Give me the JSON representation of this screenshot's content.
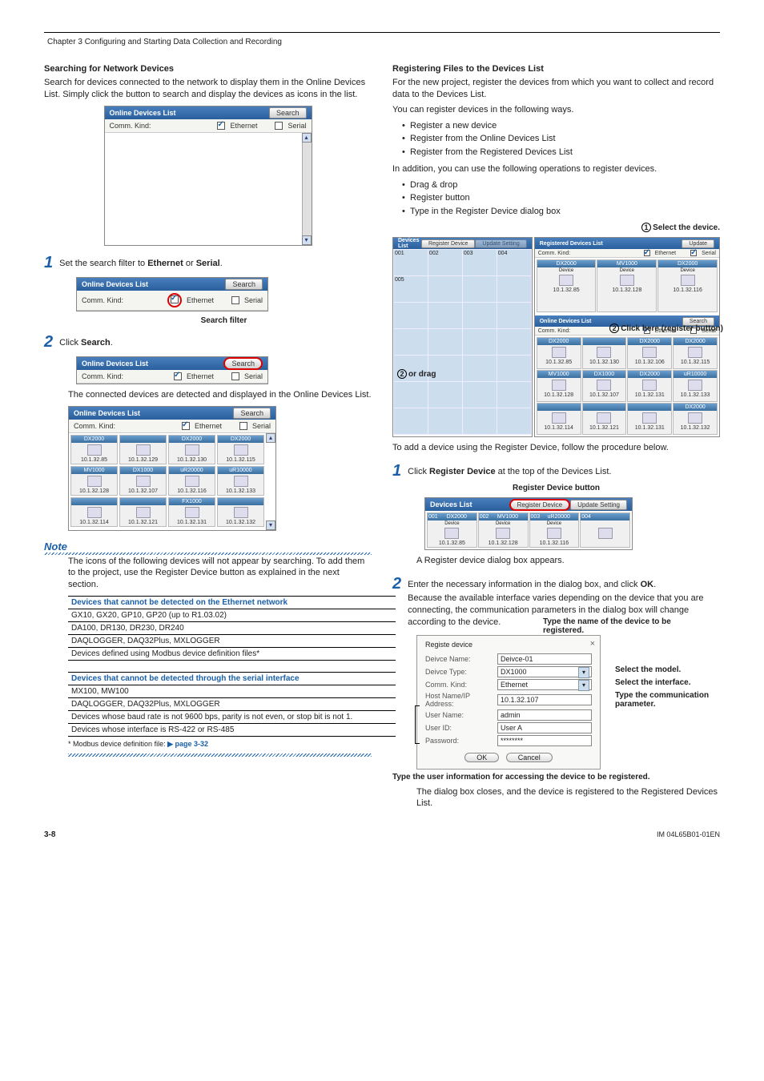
{
  "chapter": "Chapter 3  Configuring and Starting Data Collection and Recording",
  "left": {
    "h1": "Searching for Network Devices",
    "p1": "Search for devices connected to the network to display them in the Online Devices List. Simply click the button to search and display the devices as icons in the list.",
    "panel1": {
      "title": "Online Devices List",
      "search": "Search",
      "commkind": "Comm. Kind:",
      "eth": "Ethernet",
      "ser": "Serial"
    },
    "step1": "Set the search filter to Ethernet or Serial.",
    "search_filter_label": "Search filter",
    "step2": "Click Search.",
    "p2": "The connected devices are detected and displayed in the Online Devices List.",
    "devices": [
      {
        "n": "DX2000",
        "ip": "10.1.32.85"
      },
      {
        "n": "",
        "ip": "10.1.32.129"
      },
      {
        "n": "DX2000",
        "ip": "10.1.32.130"
      },
      {
        "n": "DX2000",
        "ip": "10.1.32.115"
      },
      {
        "n": "MV1000",
        "ip": "10.1.32.128"
      },
      {
        "n": "DX1000",
        "ip": "10.1.32.107"
      },
      {
        "n": "uR20000",
        "ip": "10.1.32.116"
      },
      {
        "n": "uR10000",
        "ip": "10.1.32.133"
      },
      {
        "n": "",
        "ip": "10.1.32.114"
      },
      {
        "n": "",
        "ip": "10.1.32.121"
      },
      {
        "n": "FX1000",
        "ip": "10.1.32.131"
      },
      {
        "n": "",
        "ip": "10.1.32.132"
      }
    ],
    "note": "Note",
    "note_p": "The icons of the following devices will not appear by searching. To add them to the project, use the Register Device button as explained in the next section.",
    "tbl1_hdr": "Devices that cannot be detected on the Ethernet network",
    "tbl1": [
      "GX10, GX20, GP10, GP20 (up to R1.03.02)",
      "DA100, DR130, DR230, DR240",
      "DAQLOGGER, DAQ32Plus, MXLOGGER",
      "Devices defined using Modbus device definition files*"
    ],
    "tbl2_hdr": "Devices that cannot be detected through the serial interface",
    "tbl2": [
      "MX100, MW100",
      "DAQLOGGER, DAQ32Plus, MXLOGGER",
      "Devices whose baud rate is not 9600 bps, parity is not even, or stop bit is not 1.",
      "Devices whose interface is RS-422 or RS-485"
    ],
    "footnote_pre": "*    Modbus device definition file: ",
    "footnote_link_arrow": "▶",
    "footnote_link": "page 3-32"
  },
  "right": {
    "h1": "Registering Files to the Devices List",
    "p1": "For the new project, register the devices from which you want to collect and record data to the Devices List.",
    "p2": "You can register devices in the following ways.",
    "ways": [
      "Register a new device",
      "Register from the Online Devices List",
      "Register from the Registered Devices List"
    ],
    "p3": "In addition, you can use the following operations to register devices.",
    "ops": [
      "Drag & drop",
      "Register button",
      "Type in the Register Device dialog box"
    ],
    "anno1": "Select the device.",
    "anno2": "Click here (register button)",
    "anno2b": "or drag",
    "big_panel": {
      "left_title": "Devices List",
      "left_btn1": "Register Device",
      "left_btn2": "Update Setting",
      "right_title": "Registered Devices List",
      "right_btn": "Update",
      "commkind": "Comm. Kind:",
      "eth": "Ethernet",
      "ser": "Serial",
      "online_title": "Online Devices List",
      "search": "Search"
    },
    "p4": "To add a device using the Register Device, follow the procedure below.",
    "step1": "Click Register Device at the top of the Devices List.",
    "caption1": "Register Device button",
    "mini_panel": {
      "title": "Devices List",
      "btn1": "Register Device",
      "btn2": "Update Setting",
      "items": [
        {
          "tag": "001",
          "n": "DX2000",
          "sub": "Device",
          "ip": "10.1.32.85"
        },
        {
          "tag": "002",
          "n": "MV1000",
          "sub": "Device",
          "ip": "10.1.32.128"
        },
        {
          "tag": "003",
          "n": "uR20000",
          "sub": "Device",
          "ip": "10.1.32.116"
        },
        {
          "tag": "004",
          "n": "",
          "sub": "",
          "ip": ""
        }
      ]
    },
    "p5": "A Register device dialog box appears.",
    "step2": "Enter the necessary information in the dialog box, and click OK.",
    "step2_p": "Because the available interface varies depending on the device that you are connecting, the communication parameters in the dialog box will change according to the device.",
    "dlg": {
      "title": "Registe device",
      "rows": {
        "name_l": "Deivce Name:",
        "name_v": "Deivce-01",
        "type_l": "Deivce Type:",
        "type_v": "DX1000",
        "comm_l": "Comm. Kind:",
        "comm_v": "Ethernet",
        "host_l": "Host Name/IP Address:",
        "host_v": "10.1.32.107",
        "user_l": "User Name:",
        "user_v": "admin",
        "id_l": "User ID:",
        "id_v": "User A",
        "pw_l": "Password:",
        "pw_v": "********"
      },
      "ok": "OK",
      "cancel": "Cancel"
    },
    "anno_a": "Type the name of the device to be registered.",
    "anno_b": "Select the model.",
    "anno_c": "Select the interface.",
    "anno_d": "Type the communication parameter.",
    "anno_e": "Type the user information for accessing the device to be registered.",
    "p6": "The dialog box closes, and the device is registered to the Registered Devices List."
  },
  "footer": {
    "page": "3-8",
    "doc": "IM 04L65B01-01EN"
  }
}
